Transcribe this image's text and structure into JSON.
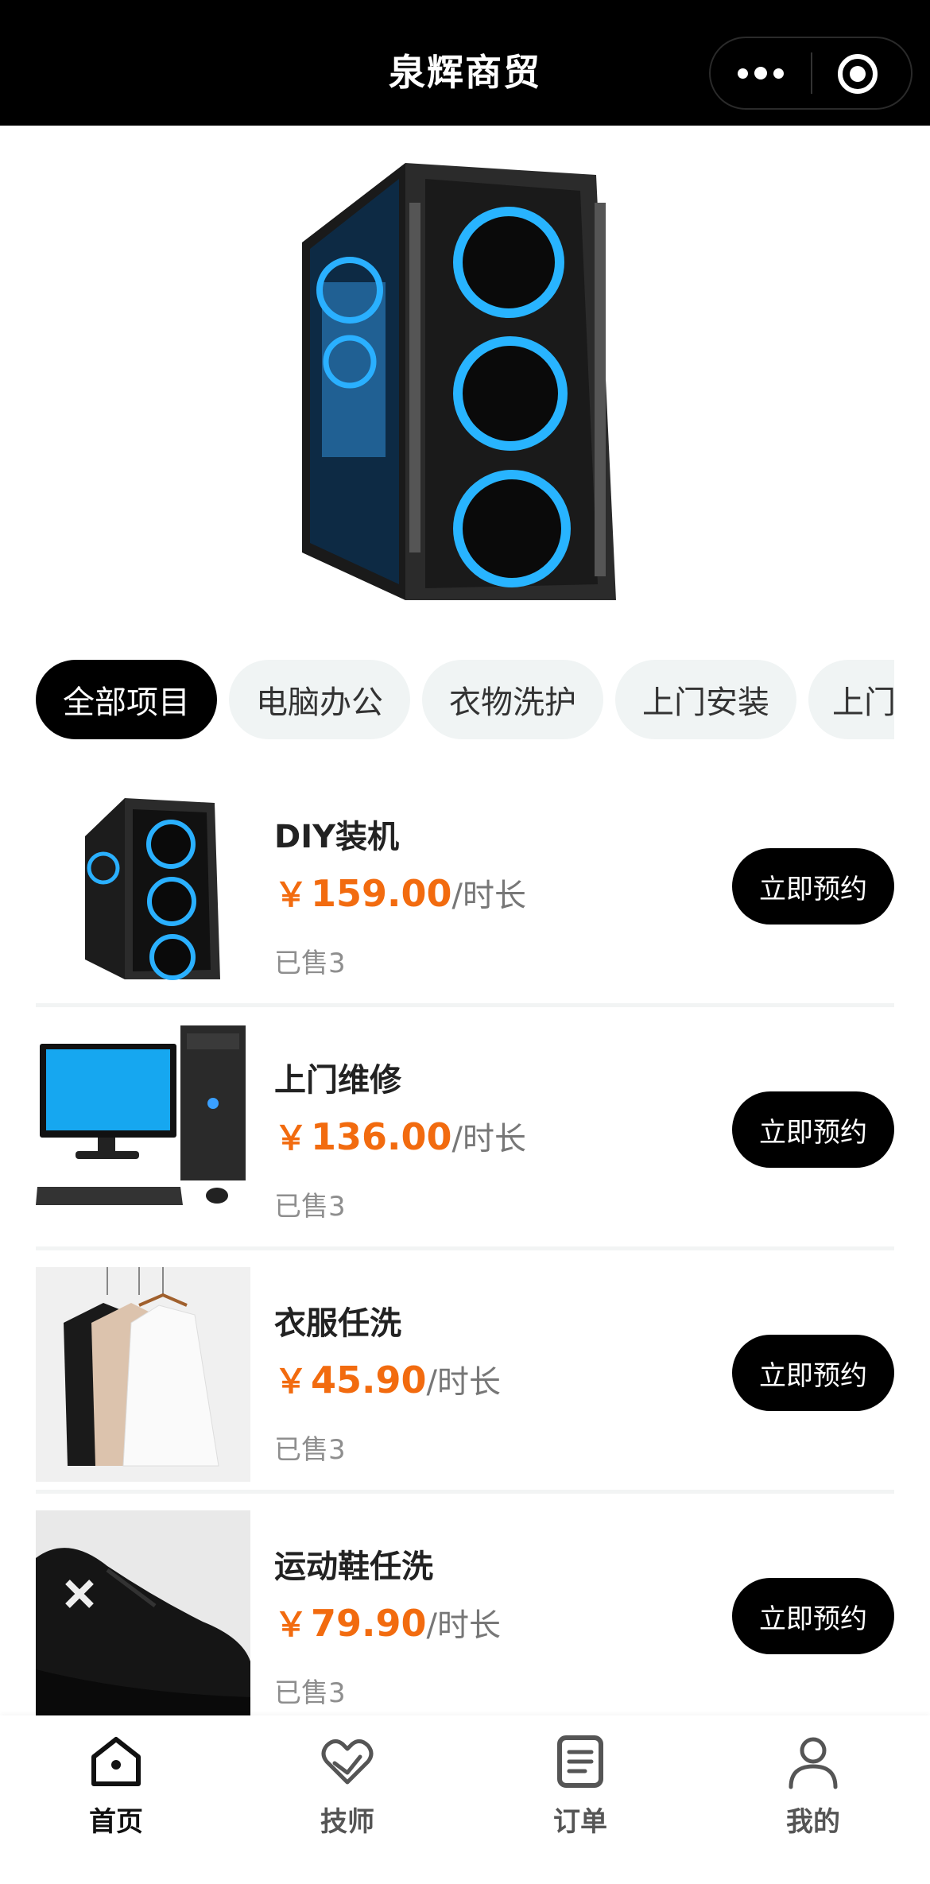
{
  "header": {
    "title": "泉辉商贸"
  },
  "tabs": [
    {
      "label": "全部项目",
      "active": true
    },
    {
      "label": "电脑办公",
      "active": false
    },
    {
      "label": "衣物洗护",
      "active": false
    },
    {
      "label": "上门安装",
      "active": false
    },
    {
      "label": "上门",
      "active": false
    }
  ],
  "items": [
    {
      "name": "DIY装机",
      "currency": "￥",
      "price": "159.00",
      "unit": "/时长",
      "sold": "已售3",
      "button": "立即预约",
      "image": "pc-case-image"
    },
    {
      "name": "上门维修",
      "currency": "￥",
      "price": "136.00",
      "unit": "/时长",
      "sold": "已售3",
      "button": "立即预约",
      "image": "desktop-computer-image"
    },
    {
      "name": "衣服任洗",
      "currency": "￥",
      "price": "45.90",
      "unit": "/时长",
      "sold": "已售3",
      "button": "立即预约",
      "image": "clothes-hanger-image"
    },
    {
      "name": "运动鞋任洗",
      "currency": "￥",
      "price": "79.90",
      "unit": "/时长",
      "sold": "已售3",
      "button": "立即预约",
      "image": "sneaker-image"
    }
  ],
  "nav": [
    {
      "label": "首页",
      "icon": "home-icon",
      "active": true
    },
    {
      "label": "技师",
      "icon": "heart-hand-icon",
      "active": false
    },
    {
      "label": "订单",
      "icon": "document-icon",
      "active": false
    },
    {
      "label": "我的",
      "icon": "user-icon",
      "active": false
    }
  ],
  "colors": {
    "price": "#f26b0f",
    "accent": "#000000",
    "tab_bg": "#f0f4f4"
  }
}
